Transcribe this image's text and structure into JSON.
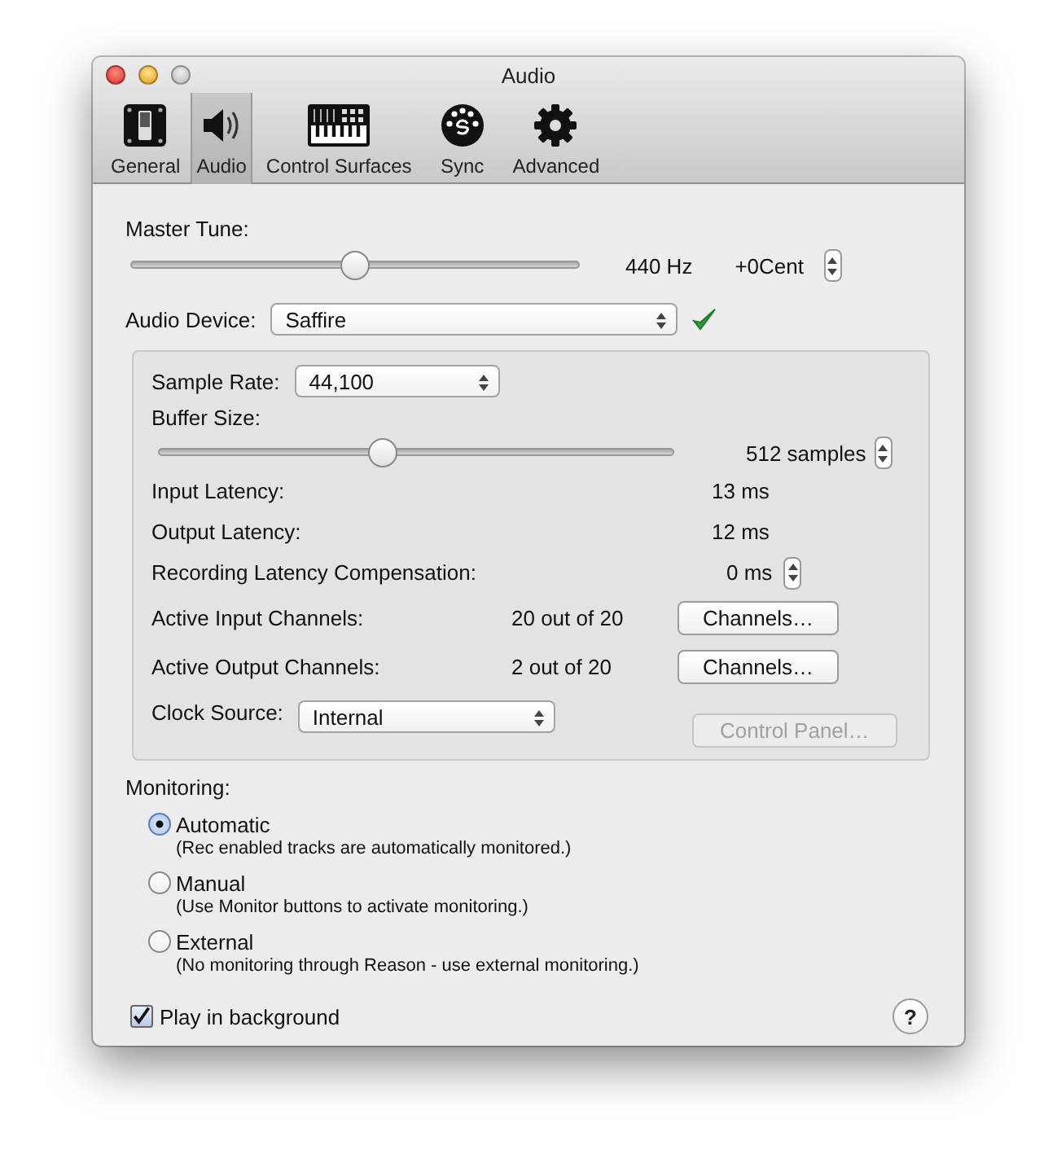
{
  "window": {
    "title": "Audio"
  },
  "toolbar": [
    {
      "label": "General",
      "kind": "general",
      "selected": false
    },
    {
      "label": "Audio",
      "kind": "audio",
      "selected": true
    },
    {
      "label": "Control Surfaces",
      "kind": "keyboard",
      "selected": false
    },
    {
      "label": "Sync",
      "kind": "sync",
      "selected": false
    },
    {
      "label": "Advanced",
      "kind": "gear",
      "selected": false
    }
  ],
  "master_tune": {
    "label": "Master Tune:",
    "level": 0.5,
    "frequency": "440 Hz",
    "cents": "+0Cent"
  },
  "audio_device": {
    "label": "Audio Device:",
    "value": "Saffire",
    "ok": true
  },
  "device_settings": {
    "sample_rate": {
      "label": "Sample Rate:",
      "value": "44,100"
    },
    "buffer_size": {
      "label": "Buffer Size:",
      "level": 0.43,
      "value": "512 samples"
    },
    "rows": [
      {
        "kind": "text",
        "label": "Input Latency:",
        "value": "13 ms"
      },
      {
        "kind": "text",
        "label": "Output Latency:",
        "value": "12 ms"
      },
      {
        "kind": "stepper",
        "label": "Recording Latency Compensation:",
        "value": "0 ms"
      },
      {
        "kind": "button",
        "label": "Active Input Channels:",
        "value": "20 out of 20",
        "button": "Channels…"
      },
      {
        "kind": "button",
        "label": "Active Output Channels:",
        "value": "2 out of 20",
        "button": "Channels…"
      }
    ],
    "clock_source": {
      "label": "Clock Source:",
      "value": "Internal"
    },
    "control_panel": {
      "label": "Control Panel…",
      "disabled": true
    }
  },
  "monitoring": {
    "label": "Monitoring:",
    "options": [
      {
        "label": "Automatic",
        "description": "(Rec enabled tracks are automatically monitored.)",
        "selected": true
      },
      {
        "label": "Manual",
        "description": "(Use Monitor buttons to activate monitoring.)",
        "selected": false
      },
      {
        "label": "External",
        "description": "(No monitoring through Reason - use external monitoring.)",
        "selected": false
      }
    ]
  },
  "play_in_background": {
    "label": "Play in background",
    "checked": true
  },
  "help": "?"
}
